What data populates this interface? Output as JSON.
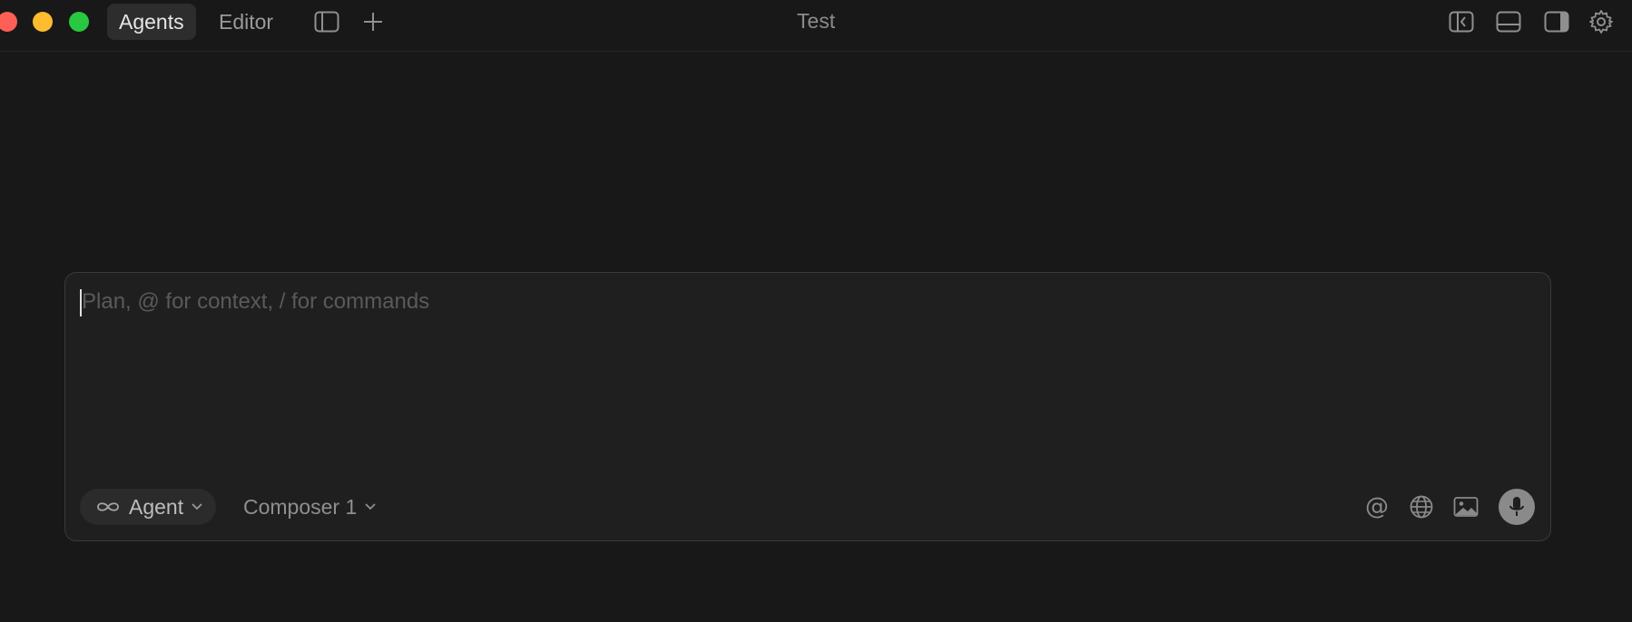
{
  "window": {
    "title": "Test"
  },
  "tabs": [
    {
      "label": "Agents",
      "active": true
    },
    {
      "label": "Editor",
      "active": false
    }
  ],
  "titlebar_icons": {
    "sidebar_toggle": "sidebar-panel-icon",
    "new_tab": "plus-icon",
    "right": [
      "collapse-left-panel-icon",
      "bottom-panel-icon",
      "right-panel-icon",
      "gear-icon"
    ]
  },
  "composer": {
    "placeholder": "Plan, @ for context, / for commands",
    "value": "",
    "mode": {
      "label": "Agent",
      "icon": "infinity-icon"
    },
    "model": {
      "label": "Composer 1"
    },
    "tools": {
      "mention": "@",
      "web": "globe-icon",
      "image": "image-icon",
      "voice": "microphone-icon"
    }
  },
  "colors": {
    "background": "#181818",
    "composer_bg": "#1f1f1f",
    "composer_border": "#3a3a3a",
    "active_tab_bg": "#2d2d2d",
    "close": "#fe5f57",
    "minimize": "#febc2e",
    "maximize": "#28c840"
  }
}
